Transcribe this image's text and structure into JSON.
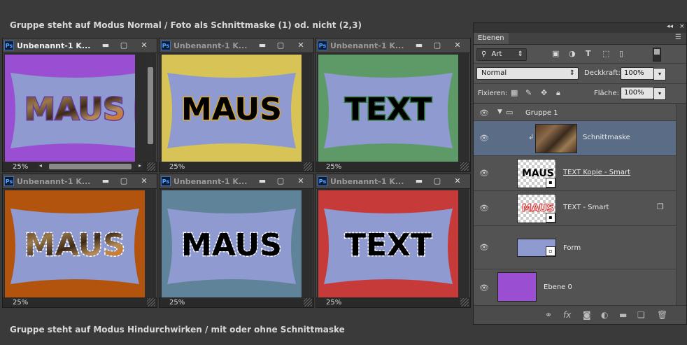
{
  "captions": {
    "top": "Gruppe steht auf Modus Normal / Foto als Schnittmaske (1) od. nicht (2,3)",
    "bottom": "Gruppe steht auf Modus Hindurchwirken / mit oder ohne Schnittmaske"
  },
  "windows": [
    {
      "title": "Unbenannt-1 K...",
      "zoom": "25%",
      "text": "MAUS",
      "bg": "#9a4fd2",
      "frame": "#8e9ad0",
      "fill": "photo",
      "outline": "#6a3aa5",
      "active": true
    },
    {
      "title": "Unbenannt-1 K...",
      "zoom": "25%",
      "text": "MAUS",
      "bg": "#d8c456",
      "frame": "#8e9ad0",
      "fill": "#000000",
      "outline": "#d9a92a",
      "active": false
    },
    {
      "title": "Unbenannt-1 K...",
      "zoom": "25%",
      "text": "TEXT",
      "bg": "#5e9a68",
      "frame": "#8e9ad0",
      "fill": "#000000",
      "outline": "#2f7a3c",
      "active": false
    },
    {
      "title": "Unbenannt-1 K...",
      "zoom": "25%",
      "text": "MAUS",
      "bg": "#b2540e",
      "frame": "#8e9ad0",
      "fill": "photo",
      "outline": "#ffffff",
      "active": false
    },
    {
      "title": "Unbenannt-1 K...",
      "zoom": "25%",
      "text": "MAUS",
      "bg": "#5f8399",
      "frame": "#8e9ad0",
      "fill": "#000000",
      "outline": "#ffffff",
      "active": false
    },
    {
      "title": "Unbenannt-1 K...",
      "zoom": "25%",
      "text": "TEXT",
      "bg": "#c63a3a",
      "frame": "#8e9ad0",
      "fill": "#000000",
      "outline": "#ffffff",
      "active": false
    }
  ],
  "panel": {
    "tab": "Ebenen",
    "filter_label": "Art",
    "blend_mode": "Normal",
    "opacity_label": "Deckkraft:",
    "opacity_value": "100%",
    "lock_label": "Fixieren:",
    "fill_label": "Fläche:",
    "fill_value": "100%",
    "layers": [
      {
        "name": "Gruppe 1",
        "type": "group"
      },
      {
        "name": "Schnittmaske",
        "type": "photo",
        "selected": true
      },
      {
        "name": "TEXT Kopie - Smart",
        "type": "smart-black",
        "thumb_text": "MAUS"
      },
      {
        "name": "TEXT - Smart",
        "type": "smart-red",
        "thumb_text": "MAUS"
      },
      {
        "name": "Form",
        "type": "shape"
      },
      {
        "name": "Ebene 0",
        "type": "fill",
        "color": "#9a4fd2"
      }
    ],
    "bottom_icons": [
      "link-icon",
      "fx-icon",
      "mask-icon",
      "adjustment-icon",
      "folder-icon",
      "new-layer-icon",
      "trash-icon"
    ]
  }
}
